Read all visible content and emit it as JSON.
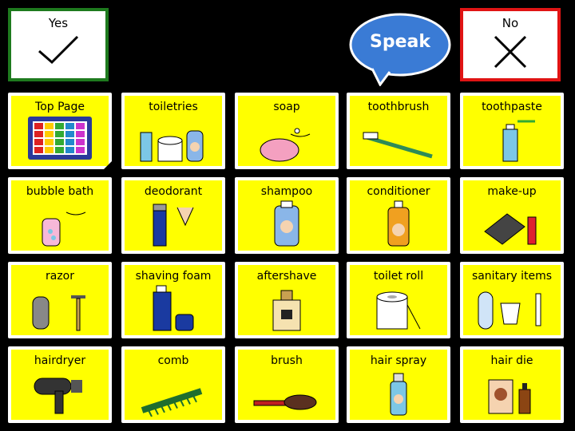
{
  "yes": {
    "label": "Yes"
  },
  "no": {
    "label": "No"
  },
  "speak": {
    "label": "Speak"
  },
  "colors": {
    "tile_bg": "#ffff00",
    "yes_border": "#1e7a1e",
    "no_border": "#e01414",
    "speak_bubble": "#3a7bd5"
  },
  "grid": [
    {
      "label": "Top Page",
      "icon": "grid-board-icon"
    },
    {
      "label": "toiletries",
      "icon": "toiletries-icon"
    },
    {
      "label": "soap",
      "icon": "soap-icon"
    },
    {
      "label": "toothbrush",
      "icon": "toothbrush-icon"
    },
    {
      "label": "toothpaste",
      "icon": "toothpaste-icon"
    },
    {
      "label": "bubble bath",
      "icon": "bubble-bath-icon"
    },
    {
      "label": "deodorant",
      "icon": "deodorant-icon"
    },
    {
      "label": "shampoo",
      "icon": "shampoo-icon"
    },
    {
      "label": "conditioner",
      "icon": "conditioner-icon"
    },
    {
      "label": "make-up",
      "icon": "make-up-icon"
    },
    {
      "label": "razor",
      "icon": "razor-icon"
    },
    {
      "label": "shaving foam",
      "icon": "shaving-foam-icon"
    },
    {
      "label": "aftershave",
      "icon": "aftershave-icon"
    },
    {
      "label": "toilet roll",
      "icon": "toilet-roll-icon"
    },
    {
      "label": "sanitary items",
      "icon": "sanitary-items-icon"
    },
    {
      "label": "hairdryer",
      "icon": "hairdryer-icon"
    },
    {
      "label": "comb",
      "icon": "comb-icon"
    },
    {
      "label": "brush",
      "icon": "brush-icon"
    },
    {
      "label": "hair spray",
      "icon": "hair-spray-icon"
    },
    {
      "label": "hair die",
      "icon": "hair-dye-icon"
    }
  ]
}
